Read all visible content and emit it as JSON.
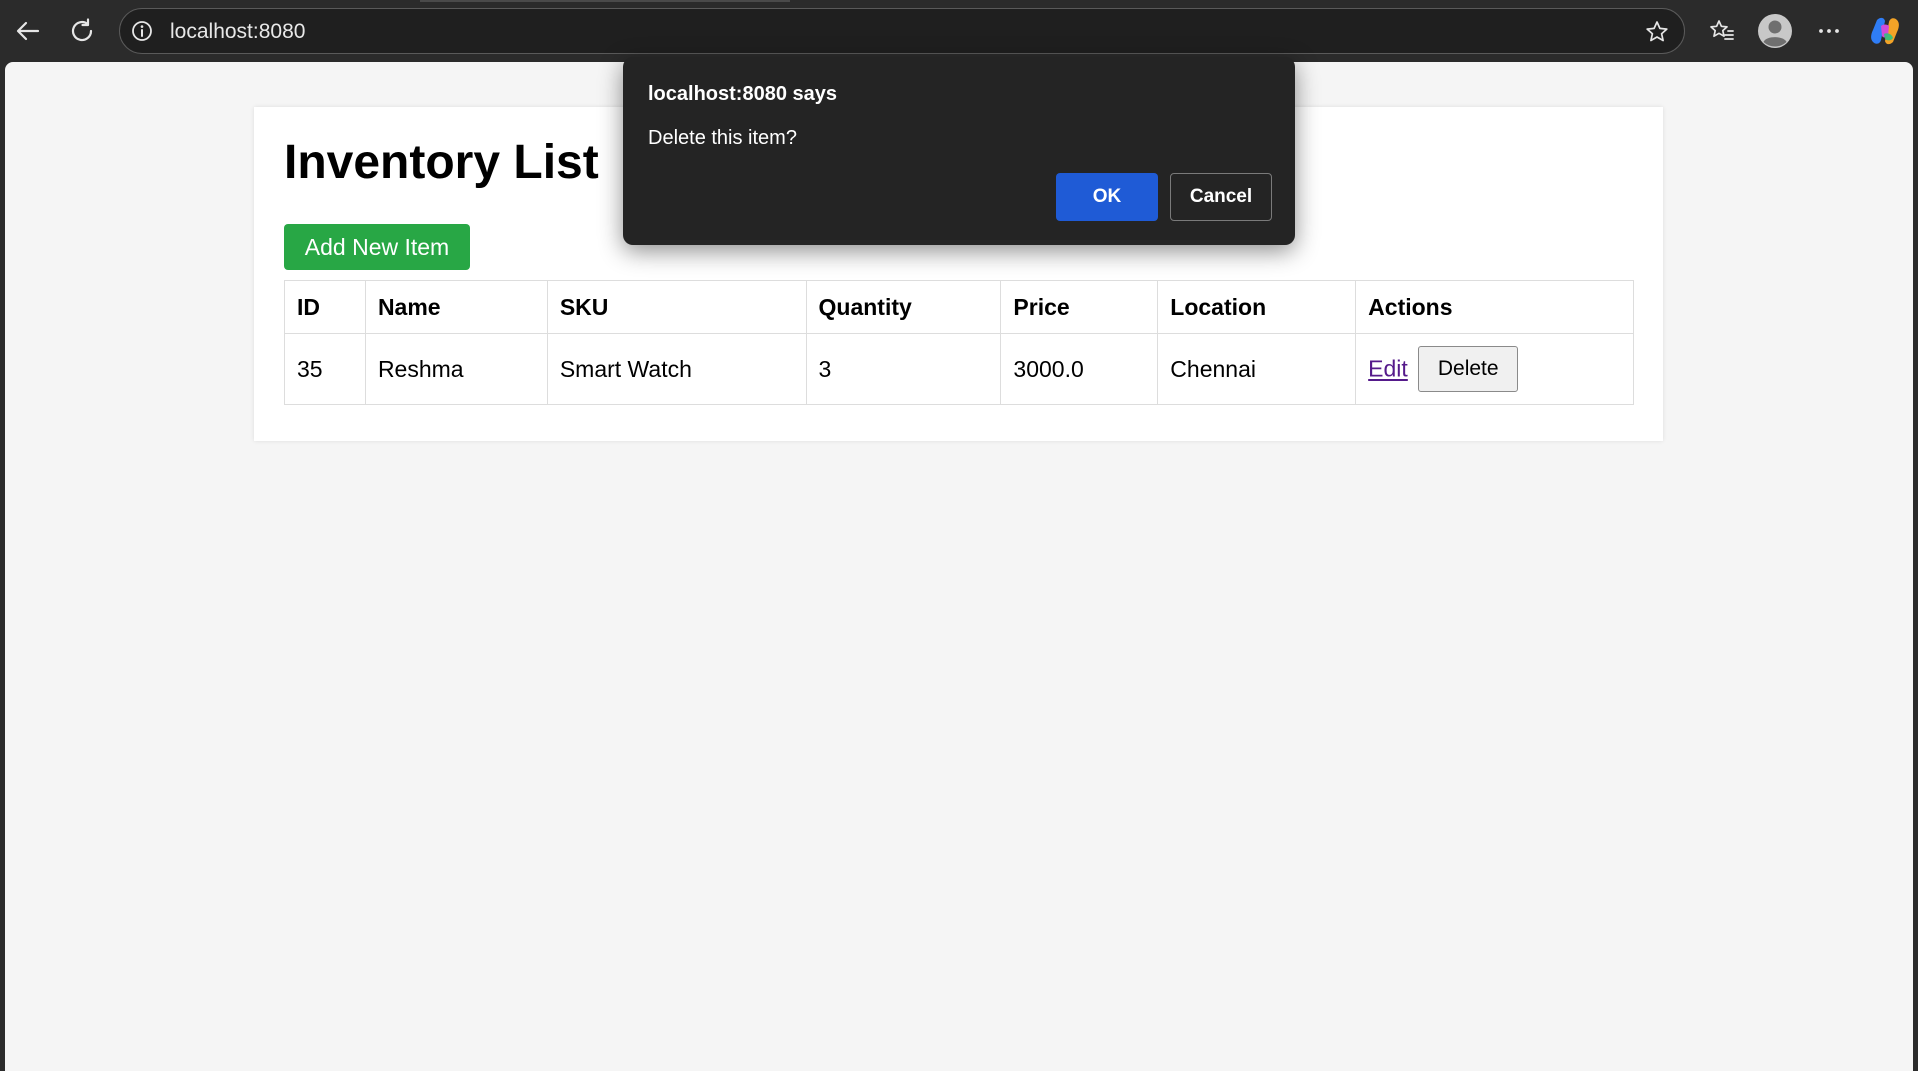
{
  "browser": {
    "url": "localhost:8080",
    "icons": {
      "back": "back-arrow-icon",
      "reload": "reload-icon",
      "site_info": "info-icon",
      "bookmark": "star-icon",
      "favorites": "favorites-icon",
      "profile": "profile-avatar-icon",
      "menu": "more-menu-icon",
      "copilot": "copilot-icon"
    }
  },
  "page": {
    "title": "Inventory List",
    "add_button_label": "Add New Item",
    "table": {
      "headers": [
        "ID",
        "Name",
        "SKU",
        "Quantity",
        "Price",
        "Location",
        "Actions"
      ],
      "rows": [
        {
          "id": "35",
          "name": "Reshma",
          "sku": "Smart Watch",
          "quantity": "3",
          "price": "3000.0",
          "location": "Chennai",
          "edit_label": "Edit",
          "delete_label": "Delete"
        }
      ]
    }
  },
  "dialog": {
    "title": "localhost:8080 says",
    "message": "Delete this item?",
    "ok_label": "OK",
    "cancel_label": "Cancel"
  },
  "colors": {
    "add_button": "#28a745",
    "dialog_ok": "#1f5bd6",
    "dialog_background": "#242424",
    "link_visited": "#551a8b",
    "browser_chrome": "#2b2b2b",
    "page_background": "#f5f5f5"
  }
}
